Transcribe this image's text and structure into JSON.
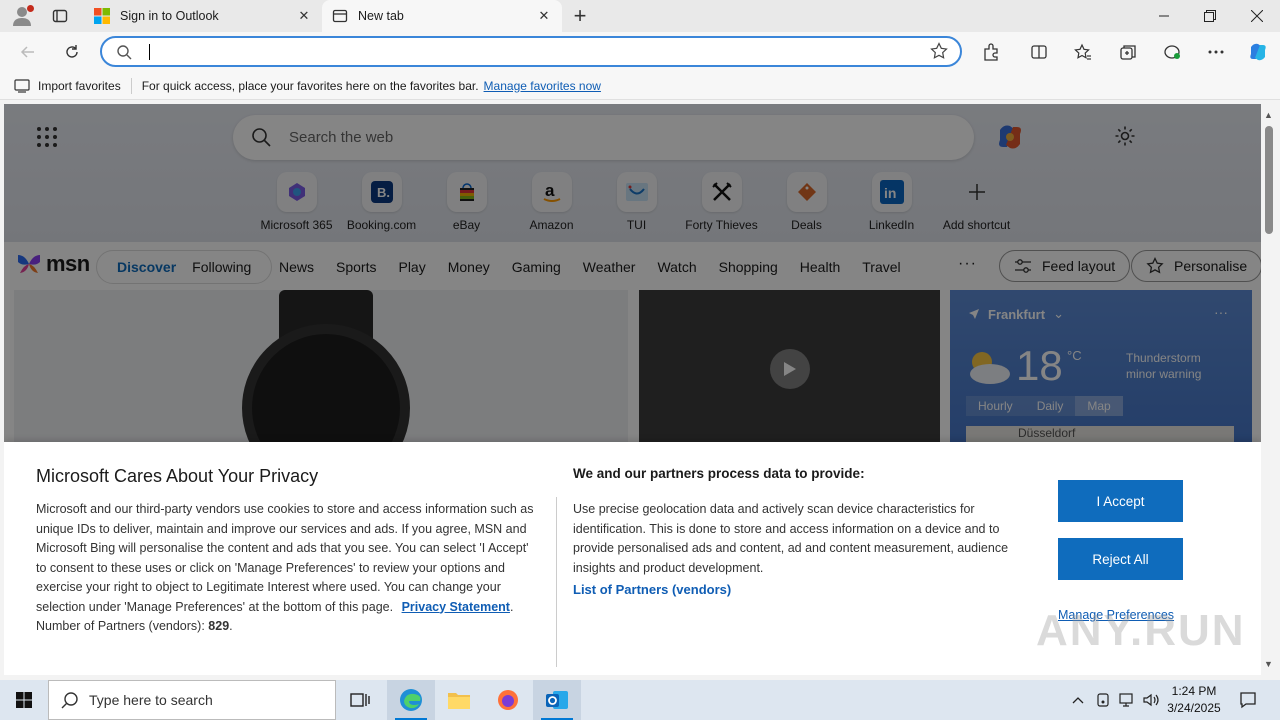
{
  "browser": {
    "tabs": [
      {
        "label": "Sign in to Outlook",
        "active": false
      },
      {
        "label": "New tab",
        "active": true
      }
    ],
    "address": {
      "value": "",
      "placeholder": ""
    },
    "favorites_bar": {
      "import_label": "Import favorites",
      "message": "For quick access, place your favorites here on the favorites bar.",
      "manage_link": "Manage favorites now"
    }
  },
  "ntp": {
    "search_placeholder": "Search the web",
    "shortcuts": [
      {
        "label": "Microsoft 365",
        "icon": "microsoft365-icon"
      },
      {
        "label": "Booking.com",
        "icon": "booking-icon"
      },
      {
        "label": "eBay",
        "icon": "ebay-icon"
      },
      {
        "label": "Amazon",
        "icon": "amazon-icon"
      },
      {
        "label": "TUI",
        "icon": "tui-icon"
      },
      {
        "label": "Forty Thieves",
        "icon": "forty-thieves-icon"
      },
      {
        "label": "Deals",
        "icon": "deals-icon"
      },
      {
        "label": "LinkedIn",
        "icon": "linkedin-icon"
      },
      {
        "label": "Add shortcut",
        "icon": "plus-icon"
      }
    ]
  },
  "msn": {
    "logo": "msn",
    "pills": [
      "Discover",
      "Following"
    ],
    "categories": [
      "News",
      "Sports",
      "Play",
      "Money",
      "Gaming",
      "Weather",
      "Watch",
      "Shopping",
      "Health",
      "Travel"
    ],
    "more": "···",
    "feed_layout": "Feed layout",
    "personalise": "Personalise"
  },
  "weather": {
    "location": "Frankfurt",
    "temp": "18",
    "unit": "°C",
    "warning_line1": "Thunderstorm",
    "warning_line2": "minor warning",
    "tabs": [
      "Hourly",
      "Daily",
      "Map"
    ],
    "map_label": "Düsseldorf",
    "dots": "···"
  },
  "privacy": {
    "title": "Microsoft Cares About Your Privacy",
    "body": "Microsoft and our third-party vendors use cookies to store and access information such as unique IDs to deliver, maintain and improve our services and ads. If you agree, MSN and Microsoft Bing will personalise the content and ads that you see. You can select 'I Accept' to consent to these uses or click on 'Manage Preferences' to review your options and exercise your right to object to Legitimate Interest where used.  You can change your selection under 'Manage Preferences' at the bottom of this page.",
    "privacy_link": "Privacy Statement",
    "partners_count_label": "Number of Partners (vendors):",
    "partners_count": "829",
    "right_title": "We and our partners process data to provide:",
    "right_body": "Use precise geolocation data and actively scan device characteristics for identification. This is done to store and access information on a device and to provide personalised ads and content, ad and content measurement, audience insights and product development.",
    "partners_link": "List of Partners (vendors)",
    "accept": "I Accept",
    "reject": "Reject All",
    "manage": "Manage Preferences"
  },
  "watermark": "ANY.RUN",
  "taskbar": {
    "search_placeholder": "Type here to search",
    "time": "1:24 PM",
    "date": "3/24/2025"
  },
  "colors": {
    "accent": "#0f6cbd",
    "link": "#0f5db4",
    "address_border": "#3b86d9"
  }
}
